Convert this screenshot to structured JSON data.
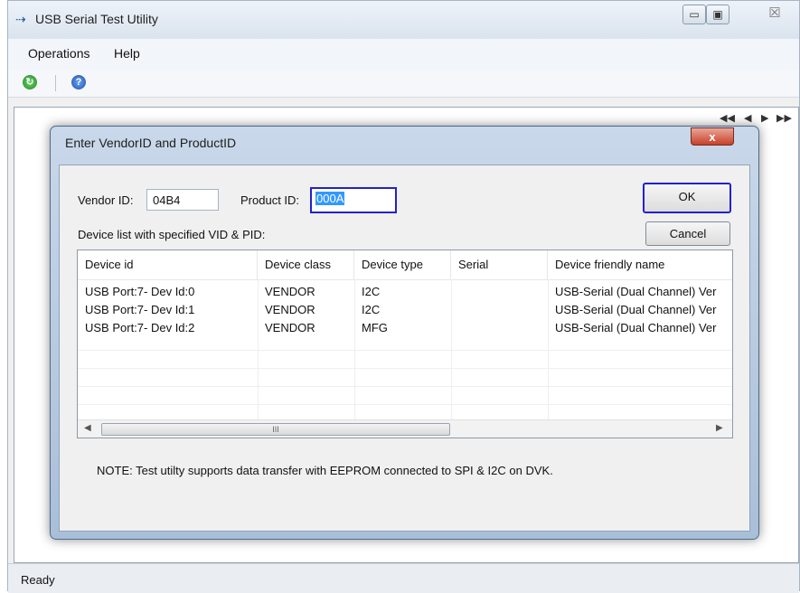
{
  "window": {
    "title": "USB Serial Test Utility",
    "app_icon": "usb-icon",
    "caption_min": "▭",
    "caption_max": "▣",
    "caption_close": "☒"
  },
  "menu": [
    "Operations",
    "Help"
  ],
  "toolbar": {
    "icons": [
      "refresh-icon",
      "help-icon"
    ]
  },
  "nav": {
    "first": "◀◀",
    "prev": "◀",
    "next": "▶",
    "last": "▶▶"
  },
  "dialog": {
    "title": "Enter VendorID and ProductID",
    "close_label": "x",
    "vendor_label": "Vendor ID:",
    "vendor_value": "04B4",
    "product_label": "Product ID:",
    "product_value": "000A",
    "ok_label": "OK",
    "cancel_label": "Cancel",
    "list_label": "Device list with specified VID & PID:",
    "columns": [
      "Device id",
      "Device class",
      "Device type",
      "Serial",
      "Device friendly name"
    ],
    "rows": [
      [
        "USB Port:7- Dev Id:0",
        "VENDOR",
        "I2C",
        "",
        "USB-Serial (Dual Channel) Ver"
      ],
      [
        "USB Port:7- Dev Id:1",
        "VENDOR",
        "I2C",
        "",
        "USB-Serial (Dual Channel) Ver"
      ],
      [
        "USB Port:7- Dev Id:2",
        "VENDOR",
        "MFG",
        "",
        "USB-Serial (Dual Channel) Ver"
      ]
    ],
    "scroll_left": "◀",
    "scroll_right": "▶",
    "scroll_grip": "III",
    "note": "NOTE: Test utilty supports data transfer with EEPROM connected to SPI & I2C on DVK."
  },
  "status": {
    "text": "Ready"
  },
  "colors": {
    "focus_border": "#2222cc",
    "selection": "#3399ff",
    "close_red": "#c7412a"
  }
}
